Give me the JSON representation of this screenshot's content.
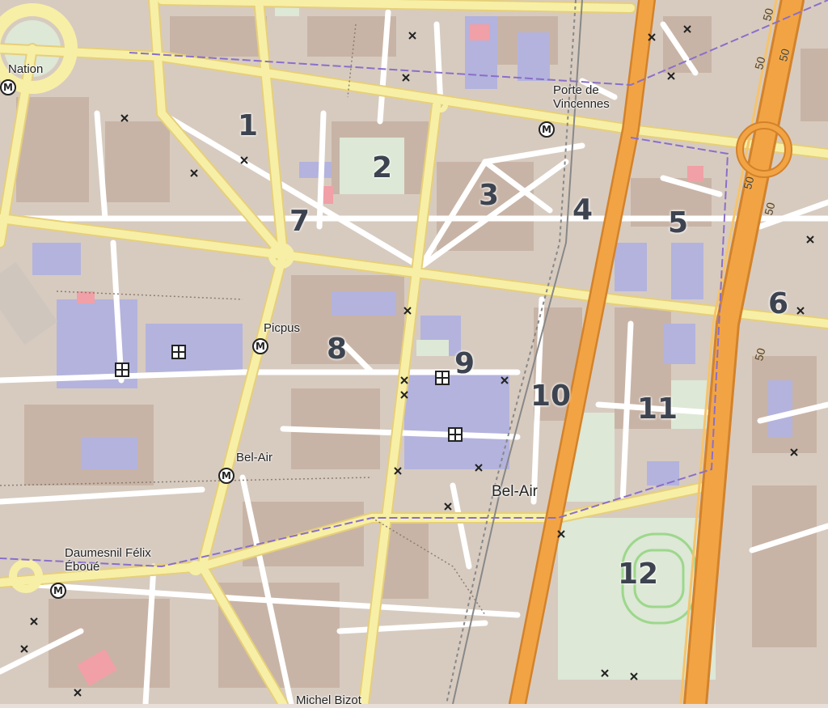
{
  "map": {
    "colors": {
      "background": "#e8e0d8",
      "block": "#d7cbc0",
      "building": "#c8b4a6",
      "public_building": "#b3b3dd",
      "park": "#dde8d6",
      "street": "#ffffff",
      "main_road": "#f7efa5",
      "main_road_border": "#e6cf7a",
      "highway": "#f2a444",
      "highway_border": "#d3822a",
      "boundary": "#8a6fc9",
      "railway": "#888888"
    },
    "district_numbers": [
      "1",
      "2",
      "3",
      "4",
      "5",
      "6",
      "7",
      "8",
      "9",
      "10",
      "11",
      "12"
    ],
    "place_labels": {
      "nation": "Nation",
      "porte_de_vincennes": "Porte de\nVincennes",
      "picpus": "Picpus",
      "bel_air_station": "Bel-Air",
      "bel_air_area": "Bel-Air",
      "daumesnil": "Daumesnil Félix\nÉboué",
      "michel_bizot": "Michel Bizot"
    },
    "metro_symbol": "M",
    "speed_label": "50",
    "icons": [
      "metro-station-icon",
      "hospital-icon",
      "crossing-marker-icon"
    ]
  }
}
